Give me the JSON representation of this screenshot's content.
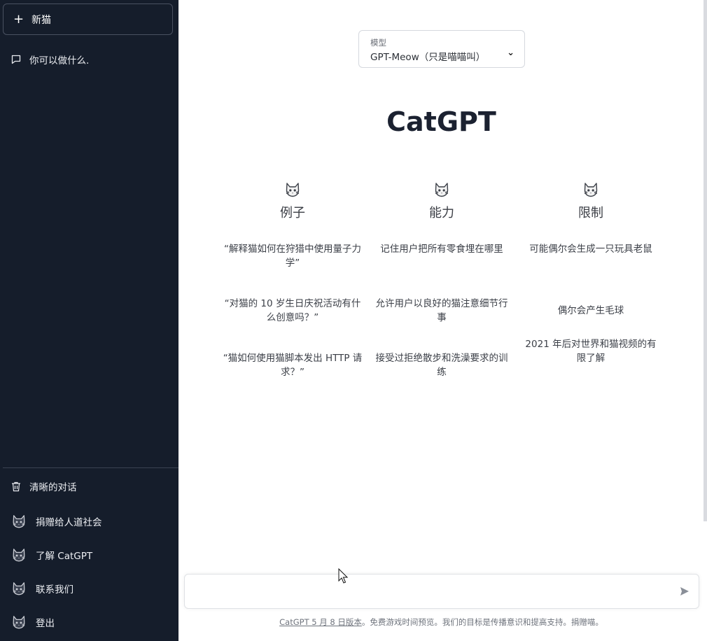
{
  "sidebar": {
    "new_chat_label": "新猫",
    "history": [
      {
        "label": "你可以做什么."
      }
    ],
    "bottom": [
      {
        "label": "清晰的对话",
        "icon": "trash-icon"
      },
      {
        "label": "捐赠给人道社会",
        "icon": "cat-avatar-icon"
      },
      {
        "label": "了解 CatGPT",
        "icon": "cat-avatar-icon"
      },
      {
        "label": "联系我们",
        "icon": "cat-avatar-icon"
      },
      {
        "label": "登出",
        "icon": "cat-avatar-icon"
      }
    ]
  },
  "model": {
    "label": "模型",
    "value": "GPT-Meow（只是喵喵叫）"
  },
  "title": "CatGPT",
  "columns": [
    {
      "heading": "例子",
      "items": [
        "“解释猫如何在狩猎中使用量子力学”",
        "“对猫的 10 岁生日庆祝活动有什么创意吗？”",
        "“猫如何使用猫脚本发出 HTTP 请求？”"
      ]
    },
    {
      "heading": "能力",
      "items": [
        "记住用户把所有零食埋在哪里",
        "允许用户以良好的猫注意细节行事",
        "接受过拒绝散步和洗澡要求的训练"
      ]
    },
    {
      "heading": "限制",
      "items": [
        "可能偶尔会生成一只玩具老鼠",
        "偶尔会产生毛球",
        "2021 年后对世界和猫视频的有限了解"
      ]
    }
  ],
  "input": {
    "placeholder": "",
    "value": ""
  },
  "footer": {
    "link_text": "CatGPT 5 月 8 日版本",
    "rest_text": "。免费游戏时间预览。我们的目标是传播意识和提高支持。捐赠喵。"
  },
  "colors": {
    "sidebar_bg": "#151d2b",
    "main_bg": "#ffffff",
    "title": "#1b2130"
  }
}
